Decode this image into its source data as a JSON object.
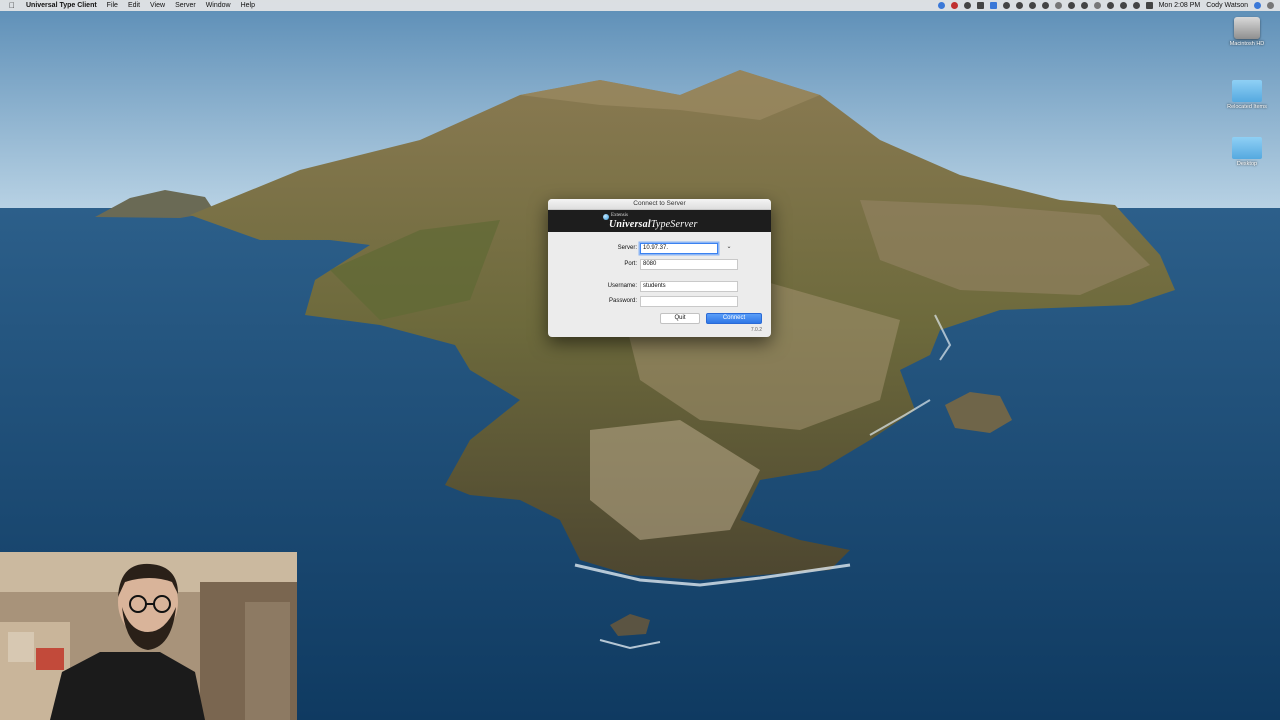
{
  "menubar": {
    "apple_icon": "apple-logo",
    "app_name": "Universal Type Client",
    "menus": [
      "File",
      "Edit",
      "View",
      "Server",
      "Window",
      "Help"
    ],
    "clock": "Mon 2:08 PM",
    "user": "Cody Watson"
  },
  "desktop": {
    "icons": [
      {
        "label": "Macintosh HD",
        "icon": "hard-drive-icon"
      },
      {
        "label": "Relocated Items",
        "icon": "folder-icon"
      },
      {
        "label": "Desktop",
        "icon": "folder-icon"
      }
    ]
  },
  "dialog": {
    "title": "Connect to Server",
    "brand_small": "Extensis",
    "brand_bold": "Universal",
    "brand_rest": "TypeServer",
    "server_label": "Server:",
    "server_value": "10.97.37.",
    "port_label": "Port:",
    "port_value": "8080",
    "username_label": "Username:",
    "username_value": "students",
    "password_label": "Password:",
    "password_value": "",
    "quit_label": "Quit",
    "connect_label": "Connect",
    "version": "7.0.2"
  },
  "colors": {
    "accent": "#2f77e6",
    "dialog_bg": "#ececec",
    "banner_bg": "#1d1d1d"
  }
}
